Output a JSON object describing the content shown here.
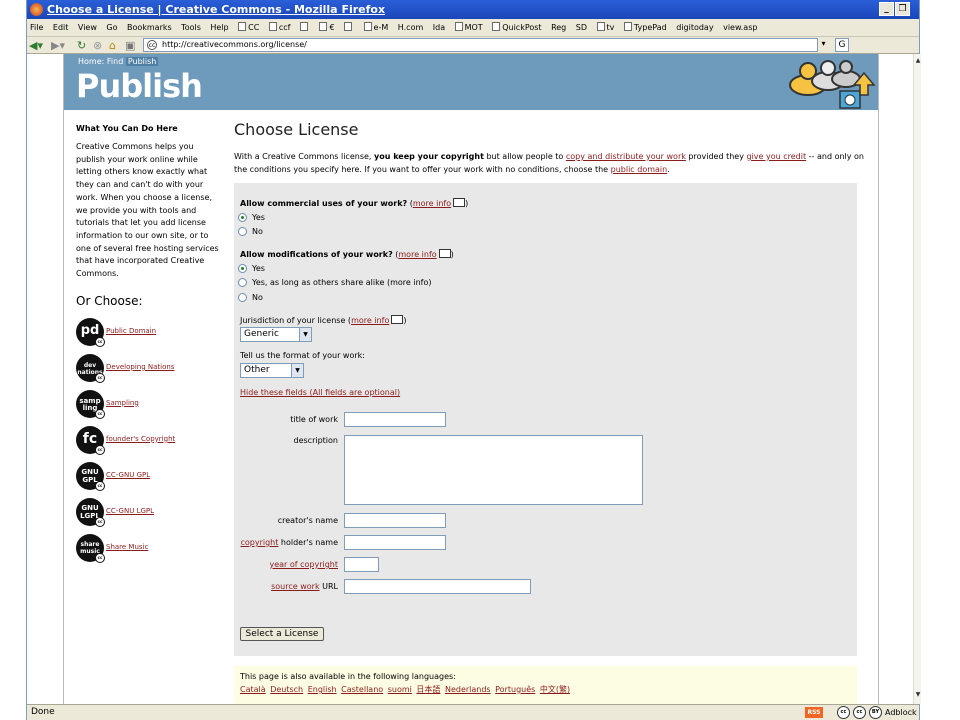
{
  "window": {
    "title": "Choose a License | Creative Commons - Mozilla Firefox"
  },
  "menu": {
    "items": [
      "File",
      "Edit",
      "View",
      "Go",
      "Bookmarks",
      "Tools",
      "Help"
    ],
    "bookmarks": [
      "CC",
      "ccf",
      "",
      "€",
      "",
      "e-M",
      "H.com",
      "Ida",
      "MOT",
      "QuickPost",
      "Reg",
      "SD",
      "tv",
      "TypePad",
      "digitoday",
      "view.asp"
    ]
  },
  "nav": {
    "url": "http://creativecommons.org/license/"
  },
  "status": {
    "text": "Done",
    "rss": "RSS",
    "cc1": "cc",
    "cc2": "cc",
    "cc3": "BY",
    "adblock": "Adblock"
  },
  "banner": {
    "crumb_home": "Home:",
    "crumb_find": "Find",
    "crumb_current": "Publish",
    "title": "Publish"
  },
  "sidebar": {
    "heading": "What You Can Do Here",
    "description": "Creative Commons helps you publish your work online while letting others know exactly what they can and can't do with your work. When you choose a license, we provide you with tools and tutorials that let you add license information to our own site, or to one of several free hosting services that have incorporated Creative Commons.",
    "or_choose": "Or Choose:",
    "options": [
      {
        "badge": "pd",
        "label": "Public Domain"
      },
      {
        "badge": "dev nations",
        "label": "Developing Nations"
      },
      {
        "badge": "samp ling",
        "label": "Sampling"
      },
      {
        "badge": "fc",
        "label": "founder's Copyright"
      },
      {
        "badge": "GNU GPL",
        "label": "CC-GNU GPL"
      },
      {
        "badge": "GNU LGPL",
        "label": "CC-GNU LGPL"
      },
      {
        "badge": "share music",
        "label": "Share Music"
      }
    ]
  },
  "main": {
    "title": "Choose License",
    "intro_1": "With a Creative Commons license, ",
    "intro_bold": "you keep your copyright",
    "intro_2": " but allow people to ",
    "intro_link1": "copy and distribute your work",
    "intro_3": " provided they ",
    "intro_link2": "give you credit",
    "intro_4": " -- and only on the conditions you specify here. If you want to offer your work with no conditions, choose the ",
    "intro_link3": "public domain",
    "intro_5": "."
  },
  "form": {
    "q1": "Allow commercial uses of your work?",
    "q1_options": [
      "Yes",
      "No"
    ],
    "q2": "Allow modifications of your work?",
    "q2_options": [
      "Yes",
      "Yes, as long as others share alike",
      "No"
    ],
    "more_info": "more info",
    "jurisdiction_label": "Jurisdiction of your license",
    "jurisdiction_value": "Generic",
    "format_label": "Tell us the format of your work:",
    "format_value": "Other",
    "hide_fields": "Hide these fields (All fields are optional)",
    "title_label": "title of work",
    "description_label": "description",
    "creator_label": "creator's name",
    "copyright_link": "copyright",
    "holder_label": " holder's name",
    "year_link": "year of copyright",
    "source_link": "source work",
    "source_label": " URL",
    "submit": "Select a License"
  },
  "languages": {
    "intro": "This page is also available in the following languages:",
    "list": [
      "Català",
      "Deutsch",
      "English",
      "Castellano",
      "suomi",
      "日本語",
      "Nederlands",
      "Português",
      "中文(繁)"
    ]
  }
}
